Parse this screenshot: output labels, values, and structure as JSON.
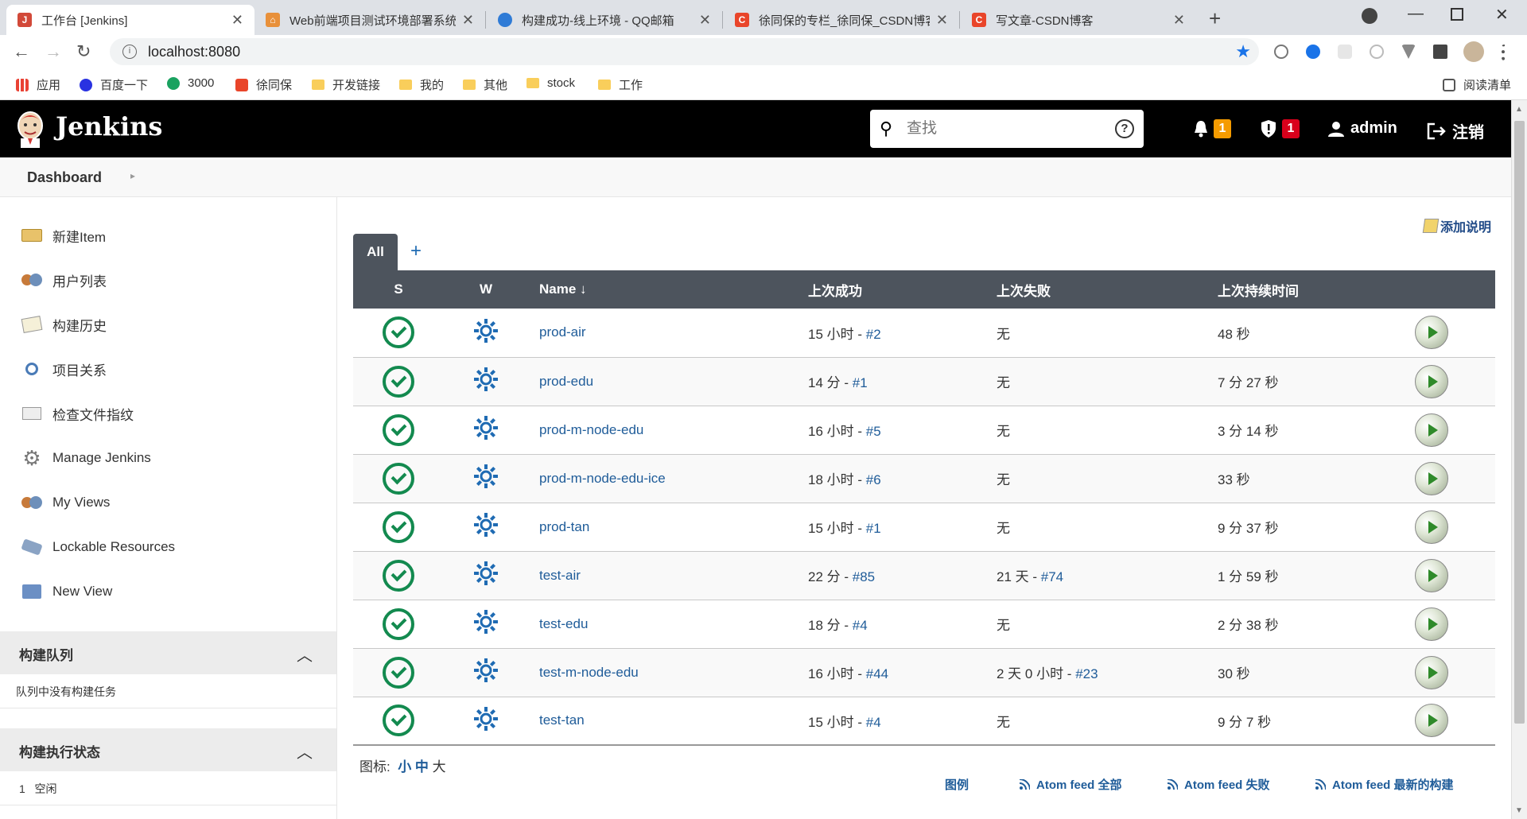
{
  "browser": {
    "tabs": [
      {
        "title": "工作台 [Jenkins]",
        "favicon_color": "#d24939",
        "active": true
      },
      {
        "title": "Web前端项目测试环境部署系统",
        "favicon_color": "#e8903a",
        "active": false
      },
      {
        "title": "构建成功-线上环境 - QQ邮箱",
        "favicon_color": "#2f7bd6",
        "active": false
      },
      {
        "title": "徐同保的专栏_徐同保_CSDN博客",
        "favicon_color": "#e9452a",
        "active": false
      },
      {
        "title": "写文章-CSDN博客",
        "favicon_color": "#e9452a",
        "active": false
      }
    ],
    "url": "localhost:8080",
    "bookmarks": [
      {
        "label": "应用",
        "type": "apps"
      },
      {
        "label": "百度一下",
        "type": "icon",
        "color": "#2932e1"
      },
      {
        "label": "3000",
        "type": "icon",
        "color": "#1aa260"
      },
      {
        "label": "徐同保",
        "type": "icon",
        "color": "#e9452a"
      },
      {
        "label": "开发链接",
        "type": "folder"
      },
      {
        "label": "我的",
        "type": "folder"
      },
      {
        "label": "其他",
        "type": "folder"
      },
      {
        "label": "stock",
        "type": "folder"
      },
      {
        "label": "工作",
        "type": "folder"
      }
    ],
    "reading_list": "阅读清单"
  },
  "header": {
    "title": "Jenkins",
    "search_placeholder": "查找",
    "help": "?",
    "notifications_count": "1",
    "security_count": "1",
    "user": "admin",
    "logout": "注销"
  },
  "breadcrumb": {
    "label": "Dashboard"
  },
  "tasks": [
    {
      "label": "新建Item",
      "icon": "new-item-icon"
    },
    {
      "label": "用户列表",
      "icon": "users-icon"
    },
    {
      "label": "构建历史",
      "icon": "notepad-icon"
    },
    {
      "label": "项目关系",
      "icon": "search-icon"
    },
    {
      "label": "检查文件指纹",
      "icon": "fingerprint-icon"
    },
    {
      "label": "Manage Jenkins",
      "icon": "gear-icon"
    },
    {
      "label": "My Views",
      "icon": "users-icon"
    },
    {
      "label": "Lockable Resources",
      "icon": "network-icon"
    },
    {
      "label": "New View",
      "icon": "folder-icon"
    }
  ],
  "build_queue": {
    "title": "构建队列",
    "empty_text": "队列中没有构建任务"
  },
  "executors": {
    "title": "构建执行状态",
    "items": [
      {
        "num": "1",
        "status": "空闲"
      }
    ]
  },
  "main": {
    "add_description": "添加说明",
    "view_tab": "All",
    "add_tab": "+",
    "columns": {
      "s": "S",
      "w": "W",
      "name": "Name ↓",
      "last_success": "上次成功",
      "last_failure": "上次失败",
      "last_duration": "上次持续时间"
    },
    "jobs": [
      {
        "name": "prod-air",
        "success_time": "15 小时 - ",
        "success_build": "#2",
        "failure_time": "无",
        "failure_build": "",
        "duration": "48 秒"
      },
      {
        "name": "prod-edu",
        "success_time": "14 分 - ",
        "success_build": "#1",
        "failure_time": "无",
        "failure_build": "",
        "duration": "7 分 27 秒"
      },
      {
        "name": "prod-m-node-edu",
        "success_time": "16 小时 - ",
        "success_build": "#5",
        "failure_time": "无",
        "failure_build": "",
        "duration": "3 分 14 秒"
      },
      {
        "name": "prod-m-node-edu-ice",
        "success_time": "18 小时 - ",
        "success_build": "#6",
        "failure_time": "无",
        "failure_build": "",
        "duration": "33 秒"
      },
      {
        "name": "prod-tan",
        "success_time": "15 小时 - ",
        "success_build": "#1",
        "failure_time": "无",
        "failure_build": "",
        "duration": "9 分 37 秒"
      },
      {
        "name": "test-air",
        "success_time": "22 分 - ",
        "success_build": "#85",
        "failure_time": "21 天 - ",
        "failure_build": "#74",
        "duration": "1 分 59 秒"
      },
      {
        "name": "test-edu",
        "success_time": "18 分 - ",
        "success_build": "#4",
        "failure_time": "无",
        "failure_build": "",
        "duration": "2 分 38 秒"
      },
      {
        "name": "test-m-node-edu",
        "success_time": "16 小时 - ",
        "success_build": "#44",
        "failure_time": "2 天 0 小时 - ",
        "failure_build": "#23",
        "duration": "30 秒"
      },
      {
        "name": "test-tan",
        "success_time": "15 小时 - ",
        "success_build": "#4",
        "failure_time": "无",
        "failure_build": "",
        "duration": "9 分 7 秒"
      }
    ],
    "icon_size_label": "图标:",
    "icon_sizes": {
      "small": "小",
      "medium": "中",
      "large": "大"
    },
    "legend": "图例",
    "feeds": {
      "all": "Atom feed 全部",
      "failures": "Atom feed 失败",
      "latest": "Atom feed 最新的构建"
    }
  },
  "colors": {
    "header_bg": "#000000",
    "table_header_bg": "#4d545d",
    "link": "#1f5c99",
    "success": "#138a4f",
    "notification_badge": "#f59b00",
    "security_badge": "#d9001b"
  }
}
